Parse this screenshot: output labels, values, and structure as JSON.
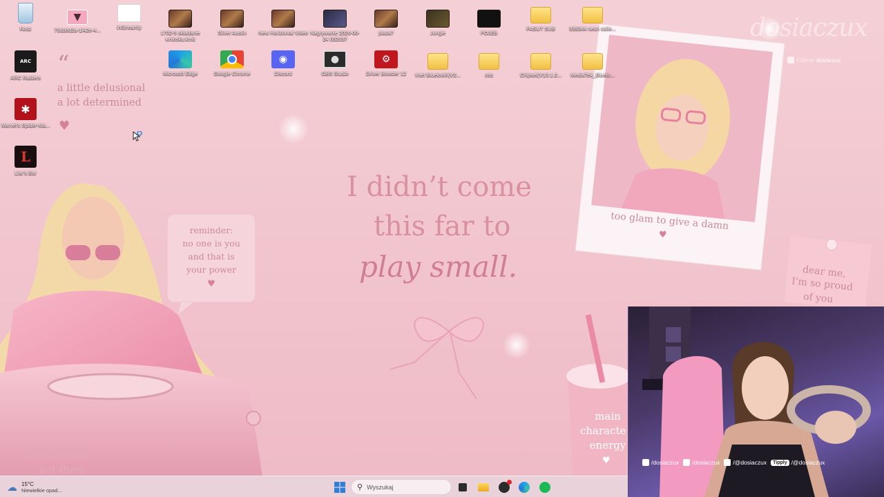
{
  "desktop_icons": [
    {
      "label": "Kosz",
      "icon": "recycle-bin-icon"
    },
    {
      "label": "73db8d2a-1f42e-4...",
      "icon": "image-file-icon"
    },
    {
      "label": "inStreamly",
      "icon": "file-icon"
    },
    {
      "label": "1702-5 składanie wniosku.kmit",
      "icon": "video-file-icon"
    },
    {
      "label": "Silver Austin",
      "icon": "video-file-icon"
    },
    {
      "label": "New Horizontal Video",
      "icon": "video-file-icon"
    },
    {
      "label": "Nagrywanie 2026-06-24 032037",
      "icon": "video-file-icon"
    },
    {
      "label": "plaza7",
      "icon": "video-file-icon"
    },
    {
      "label": "Jungle",
      "icon": "video-file-icon"
    },
    {
      "label": "POJEB",
      "icon": "video-file-icon"
    },
    {
      "label": "PASUT SUB",
      "icon": "folder-icon"
    },
    {
      "label": "939344 neon colle...",
      "icon": "folder-icon"
    },
    {
      "label": "ARC Raiders",
      "icon": "arc-raiders-icon"
    },
    {
      "label": "Marvel's Spider-Ma...",
      "icon": "spider-man-icon"
    },
    {
      "label": "Liar's Bar",
      "icon": "liars-bar-icon"
    },
    {
      "label": "Microsoft Edge",
      "icon": "edge-icon"
    },
    {
      "label": "Google Chrome",
      "icon": "chrome-icon"
    },
    {
      "label": "Discord",
      "icon": "discord-icon"
    },
    {
      "label": "OBS Studio",
      "icon": "obs-icon"
    },
    {
      "label": "Driver Booster 12",
      "icon": "driver-booster-icon"
    },
    {
      "label": "Intel Bluetooth(V2...",
      "icon": "folder-icon"
    },
    {
      "label": "cos",
      "icon": "folder-icon"
    },
    {
      "label": "Chipset(V10.1.2...",
      "icon": "folder-icon"
    },
    {
      "label": "MediaTek_Blueto...",
      "icon": "folder-icon"
    }
  ],
  "wallpaper": {
    "quote_mark": "“",
    "quote_line1": "a little delusional",
    "quote_line2": "a lot determined",
    "main_line1": "I didn’t come",
    "main_line2": "this far to",
    "main_line3": "play small.",
    "reminder_line1": "reminder:",
    "reminder_line2": "no one is you",
    "reminder_line3": "and that is",
    "reminder_line4": "your power",
    "polaroid_caption": "too glam to give a damn",
    "note_line1": "dear me,",
    "note_line2": "I'm so proud",
    "note_line3": "of you",
    "drink_line1": "main",
    "drink_line2": "characte",
    "drink_line3": "energy",
    "focus_line1": "focus on me,",
    "focus_line2": "not them",
    "heart": "♥"
  },
  "watermark": {
    "logo_text": "dosiaczux",
    "handle_prefix": "/Odmie",
    "handle": "dosiaczux"
  },
  "taskbar": {
    "weather_temp": "15°C",
    "weather_desc": "Niewielkie opad...",
    "search_placeholder": "Wyszukaj"
  },
  "webcam_overlay": {
    "instagram": "/dosiaczux",
    "tiktok": "/dosiaczux",
    "youtube": "/@dosiaczux",
    "tipply_badge": "Tipply",
    "tipply": "/@dosiaczux"
  }
}
